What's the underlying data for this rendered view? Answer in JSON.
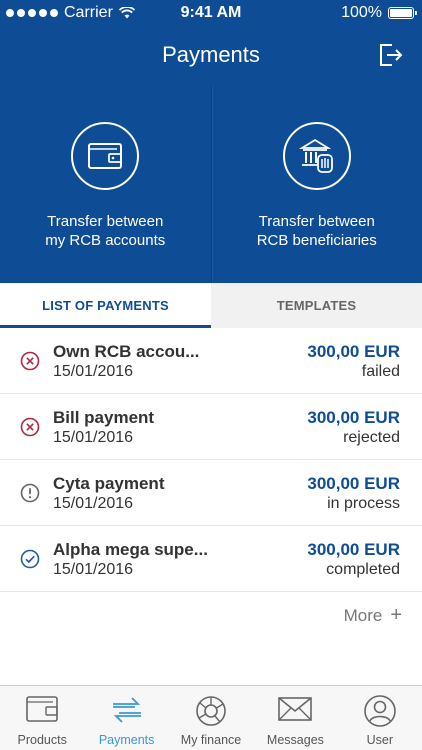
{
  "status_bar": {
    "carrier": "Carrier",
    "time": "9:41 AM",
    "battery": "100%"
  },
  "header": {
    "title": "Payments",
    "logout_icon": "logout-icon"
  },
  "tiles": [
    {
      "label_line1": "Transfer between",
      "label_line2": "my RCB accounts",
      "icon": "wallet-icon"
    },
    {
      "label_line1": "Transfer between",
      "label_line2": "RCB beneficiaries",
      "icon": "bank-icon"
    }
  ],
  "tabs": [
    {
      "label": "LIST OF PAYMENTS",
      "active": true
    },
    {
      "label": "TEMPLATES",
      "active": false
    }
  ],
  "payments": [
    {
      "title": "Own RCB accou...",
      "date": "15/01/2016",
      "amount": "300,00 EUR",
      "status": "failed",
      "icon": "error-icon"
    },
    {
      "title": "Bill payment",
      "date": "15/01/2016",
      "amount": "300,00 EUR",
      "status": "rejected",
      "icon": "error-icon"
    },
    {
      "title": "Cyta payment",
      "date": "15/01/2016",
      "amount": "300,00 EUR",
      "status": "in process",
      "icon": "warning-icon"
    },
    {
      "title": "Alpha mega supe...",
      "date": "15/01/2016",
      "amount": "300,00 EUR",
      "status": "completed",
      "icon": "check-icon"
    }
  ],
  "more": {
    "label": "More",
    "icon": "plus-icon"
  },
  "tabbar": [
    {
      "label": "Products",
      "icon": "wallet-icon",
      "active": false
    },
    {
      "label": "Payments",
      "icon": "transfer-arrows-icon",
      "active": true
    },
    {
      "label": "My finance",
      "icon": "pie-chart-icon",
      "active": false
    },
    {
      "label": "Messages",
      "icon": "envelope-icon",
      "active": false
    },
    {
      "label": "User",
      "icon": "user-icon",
      "active": false
    }
  ],
  "colors": {
    "brand_blue": "#0e4d96",
    "error_red": "#b0293f",
    "success_blue": "#1f5fa8",
    "tab_active": "#3a98d8"
  }
}
